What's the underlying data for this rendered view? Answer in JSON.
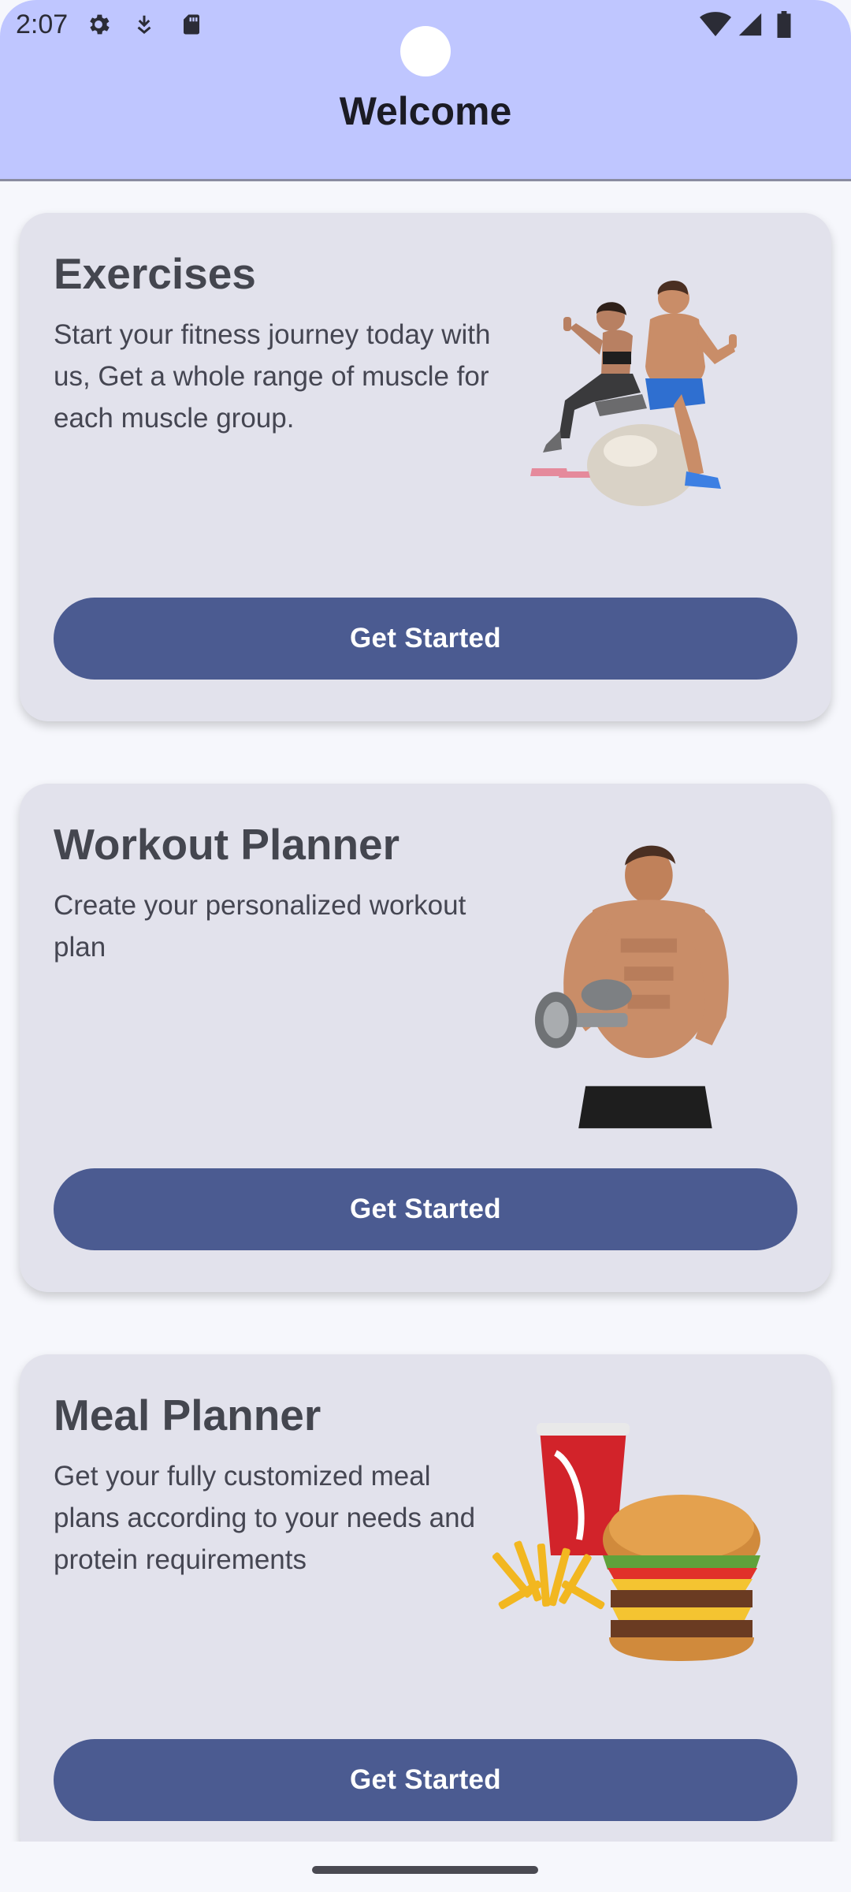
{
  "status_bar": {
    "time": "2:07",
    "left_icons": [
      "gear-icon",
      "download-icon",
      "sd-card-icon"
    ],
    "right_icons": [
      "wifi-icon",
      "cell-signal-icon",
      "battery-icon"
    ]
  },
  "header": {
    "title": "Welcome",
    "background": "#bfc6ff"
  },
  "cards": [
    {
      "title": "Exercises",
      "description": "Start your fitness journey today with us, Get a whole range of muscle for each muscle group.",
      "illustration": "couple-exercise-ball-image",
      "button_label": "Get Started"
    },
    {
      "title": "Workout Planner",
      "description": "Create your personalized workout plan",
      "illustration": "bodybuilder-dumbbell-image",
      "button_label": "Get Started"
    },
    {
      "title": "Meal Planner",
      "description": "Get your fully customized meal plans according to your needs and protein requirements",
      "illustration": "burger-fries-soda-image",
      "button_label": "Get Started"
    }
  ],
  "colors": {
    "card_background": "#e2e2ec",
    "button": "#4b5b91",
    "button_text": "#ffffff",
    "page_background": "#f6f7fc"
  }
}
